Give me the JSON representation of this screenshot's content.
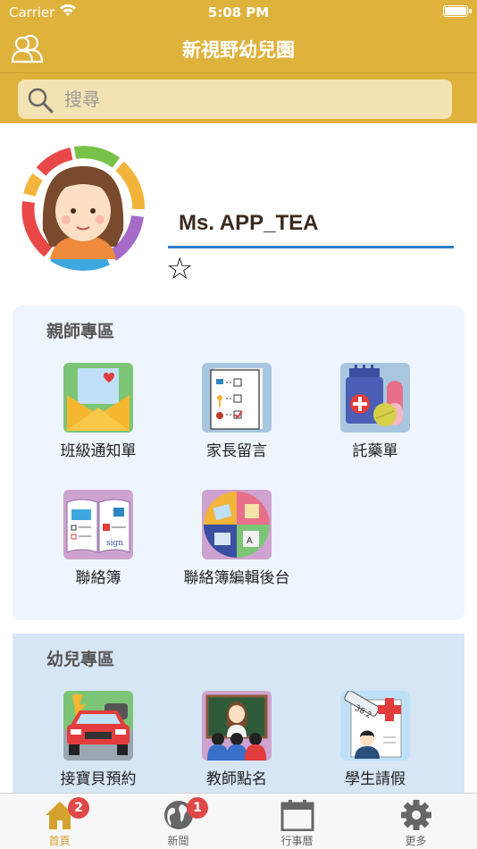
{
  "status_bar": {
    "carrier": "Carrier",
    "time": "5:08 PM"
  },
  "header": {
    "title": "新視野幼兒園"
  },
  "search": {
    "placeholder": "搜尋"
  },
  "profile": {
    "name": "Ms. APP_TEA",
    "favorite_icon": "star-outline-icon"
  },
  "sections": [
    {
      "title": "親師專區",
      "items": [
        {
          "label": "班級通知單",
          "icon": "notice-envelope-icon"
        },
        {
          "label": "家長留言",
          "icon": "checklist-icon"
        },
        {
          "label": "託藥單",
          "icon": "medicine-icon"
        },
        {
          "label": "聯絡簿",
          "icon": "contact-book-icon"
        },
        {
          "label": "聯絡簿編輯後台",
          "icon": "editor-backend-icon"
        }
      ]
    },
    {
      "title": "幼兒專區",
      "items": [
        {
          "label": "接寶貝預約",
          "icon": "car-pickup-icon"
        },
        {
          "label": "教師點名",
          "icon": "teacher-rollcall-icon"
        },
        {
          "label": "學生請假",
          "icon": "student-leave-icon"
        }
      ]
    }
  ],
  "tabbar": {
    "tabs": [
      {
        "label": "首頁",
        "icon": "home-icon",
        "badge": "2",
        "active": true
      },
      {
        "label": "新聞",
        "icon": "globe-icon",
        "badge": "1",
        "active": false
      },
      {
        "label": "行事曆",
        "icon": "calendar-icon",
        "badge": "",
        "active": false
      },
      {
        "label": "更多",
        "icon": "gear-icon",
        "badge": "",
        "active": false
      }
    ]
  },
  "colors": {
    "accent": "#dfb23c",
    "search_bg": "#f4e3b2",
    "underline": "#2f7fc7",
    "badge": "#e04848",
    "active_tab": "#d4a22e"
  }
}
